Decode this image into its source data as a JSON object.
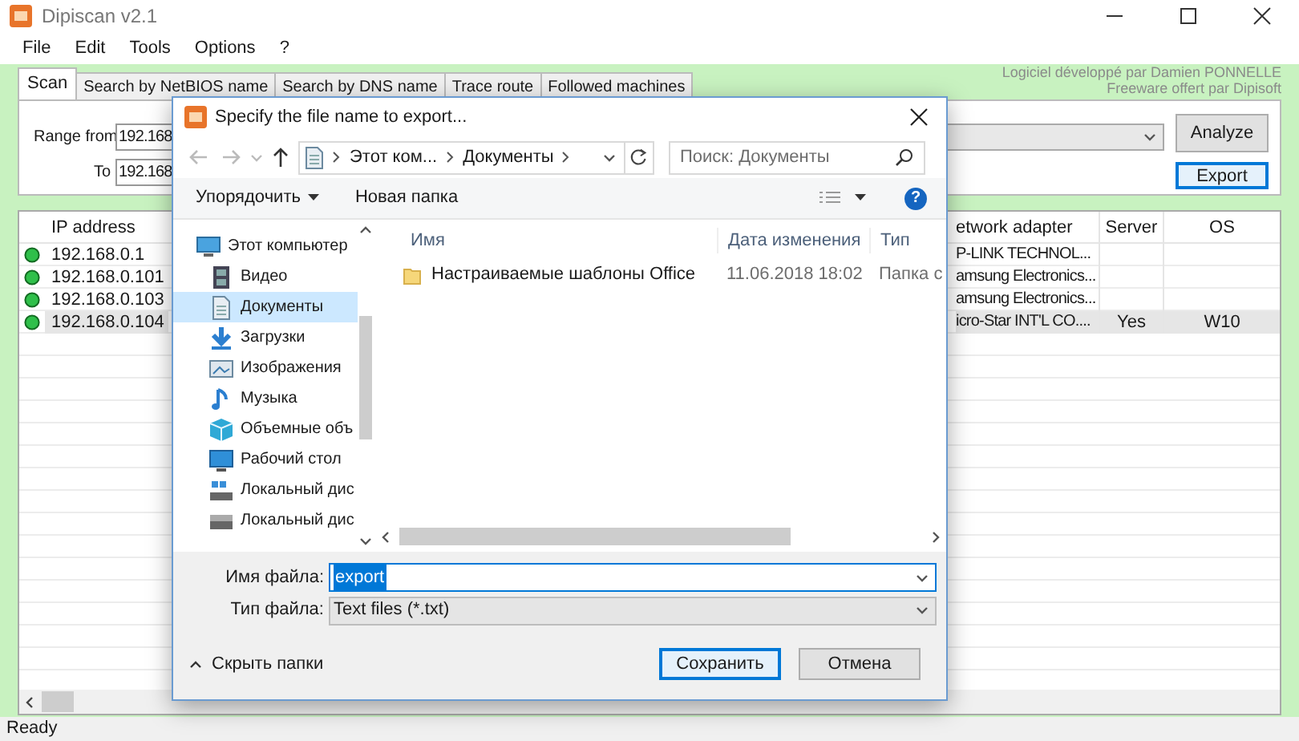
{
  "window": {
    "title": "Dipiscan v2.1"
  },
  "menu": [
    "File",
    "Edit",
    "Tools",
    "Options",
    "?"
  ],
  "credits": [
    "Logiciel développé par Damien PONNELLE",
    "Freeware offert par Dipisoft"
  ],
  "tabs": [
    {
      "label": "Scan",
      "selected": true
    },
    {
      "label": "Search by NetBIOS name",
      "selected": false
    },
    {
      "label": "Search by DNS name",
      "selected": false
    },
    {
      "label": "Trace route",
      "selected": false
    },
    {
      "label": "Followed machines",
      "selected": false
    }
  ],
  "range": {
    "from_label": "Range from",
    "from_value": "192.168",
    "to_label": "To",
    "to_value": "192.168"
  },
  "buttons": {
    "analyze": "Analyze",
    "export": "Export"
  },
  "table": {
    "columns": [
      "IP address",
      "etwork adapter",
      "Server",
      "OS"
    ],
    "rows": [
      {
        "online": true,
        "ip": "192.168.0.1",
        "adapter": "P-LINK TECHNOL...",
        "selected": false
      },
      {
        "online": true,
        "ip": "192.168.0.101",
        "adapter": "amsung Electronics...",
        "selected": false
      },
      {
        "online": true,
        "ip": "192.168.0.103",
        "adapter": "amsung Electronics...",
        "selected": false
      },
      {
        "online": true,
        "ip": "192.168.0.104",
        "adapter": "icro-Star INT'L CO....",
        "server": "Yes",
        "os": "W10",
        "selected": true
      }
    ]
  },
  "status_bar": "Ready",
  "dialog": {
    "title": "Specify the file name to export...",
    "breadcrumb": [
      "Этот ком...",
      "Документы"
    ],
    "search": {
      "placeholder": "Поиск: Документы"
    },
    "toolbar": {
      "organize": "Упорядочить",
      "new_folder": "Новая папка",
      "help": "?"
    },
    "nav": [
      {
        "label": "Этот компьютер",
        "kind": "computer",
        "selected": false,
        "children": [
          {
            "label": "Видео",
            "kind": "video",
            "selected": false
          },
          {
            "label": "Документы",
            "kind": "document",
            "selected": true
          },
          {
            "label": "Загрузки",
            "kind": "download",
            "selected": false
          },
          {
            "label": "Изображения",
            "kind": "image",
            "selected": false
          },
          {
            "label": "Музыка",
            "kind": "music",
            "selected": false
          },
          {
            "label": "Объемные объ",
            "kind": "cube",
            "selected": false
          },
          {
            "label": "Рабочий стол",
            "kind": "desktop",
            "selected": false
          },
          {
            "label": "Локальный дис",
            "kind": "drive_os",
            "selected": false
          },
          {
            "label": "Локальный дис",
            "kind": "drive",
            "selected": false
          }
        ]
      }
    ],
    "files": {
      "columns": [
        "Имя",
        "Дата изменения",
        "Тип"
      ],
      "rows": [
        {
          "name": "Настраиваемые шаблоны Office",
          "date": "11.06.2018 18:02",
          "type": "Папка с"
        }
      ]
    },
    "file_name": {
      "label": "Имя файла:",
      "value": "export",
      "text_selected": true
    },
    "file_type": {
      "label": "Тип файла:",
      "value": "Text files (*.txt)"
    },
    "hide_folders": "Скрыть папки",
    "actions": [
      {
        "label": "Сохранить",
        "default": true
      },
      {
        "label": "Отмена",
        "default": false
      }
    ]
  }
}
